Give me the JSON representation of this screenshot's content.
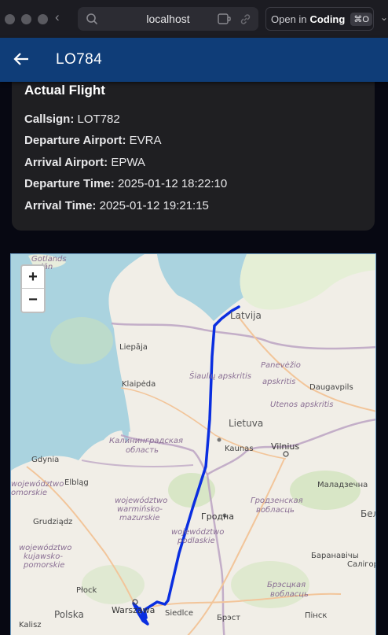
{
  "browser": {
    "url": "localhost",
    "open_in_prefix": "Open in",
    "open_in_app": "Coding",
    "shortcut": "⌘O",
    "icons": [
      "search-icon",
      "extension-icon",
      "link-icon",
      "back-chevron-icon"
    ]
  },
  "header": {
    "title": "LO784",
    "back_icon": "arrow-left-icon",
    "color": "#0f3d78"
  },
  "actual_flight": {
    "heading": "Actual Flight",
    "callsign_label": "Callsign:",
    "callsign": "LOT782",
    "departure_airport_label": "Departure Airport:",
    "departure_airport": "EVRA",
    "arrival_airport_label": "Arrival Airport:",
    "arrival_airport": "EPWA",
    "departure_time_label": "Departure Time:",
    "departure_time": "2025-01-12 18:22:10",
    "arrival_time_label": "Arrival Time:",
    "arrival_time": "2025-01-12 19:21:15"
  },
  "map": {
    "zoom_in": "+",
    "zoom_out": "−",
    "route_color": "#0a2ee0",
    "labels": {
      "gotlands": "Gotlands",
      "gotlands2": "län",
      "latvija": "Latvija",
      "liepaja": "Liepāja",
      "klaipeda": "Klaipėda",
      "siauliai": "Šiaulių apskritis",
      "panevezio": "Panevėžio",
      "panevezio2": "apskritis",
      "daugavpils": "Daugavpils",
      "utenos": "Utenos apskritis",
      "lietuva": "Lietuva",
      "kaliningrad": "Калинингpадская",
      "kaliningrad2": "область",
      "kaunas": "Kaunas",
      "vilnius": "Vilnius",
      "gdynia": "Gdynia",
      "pomorskie": "województwo",
      "pomorskie2": "omorskie",
      "elblag": "Elbląg",
      "maladzechna": "Маладзечна",
      "warminsko": "województwo",
      "warminsko2": "warmińsko-",
      "warminsko3": "mazurskie",
      "grodno_obl": "Гродзенская",
      "grodno_obl2": "вобласць",
      "grudziadz": "Grudziądz",
      "hrodna": "Гродна",
      "podlaskie": "województwo",
      "podlaskie2": "podlaskie",
      "bel": "Бел",
      "kujawsko": "województwo",
      "kujawsko2": "kujawsko-",
      "kujawsko3": "pomorskie",
      "baranavichy": "Баранавічы",
      "salihorsk": "Салігор",
      "plock": "Płock",
      "brest_obl": "Брэсцкая",
      "brest_obl2": "вобласць",
      "warszawa": "Warszawa",
      "siedlce": "Siedlce",
      "polska": "Polska",
      "brest": "Брэст",
      "pinsk": "Пінск",
      "kalisz": "Kalisz"
    }
  }
}
